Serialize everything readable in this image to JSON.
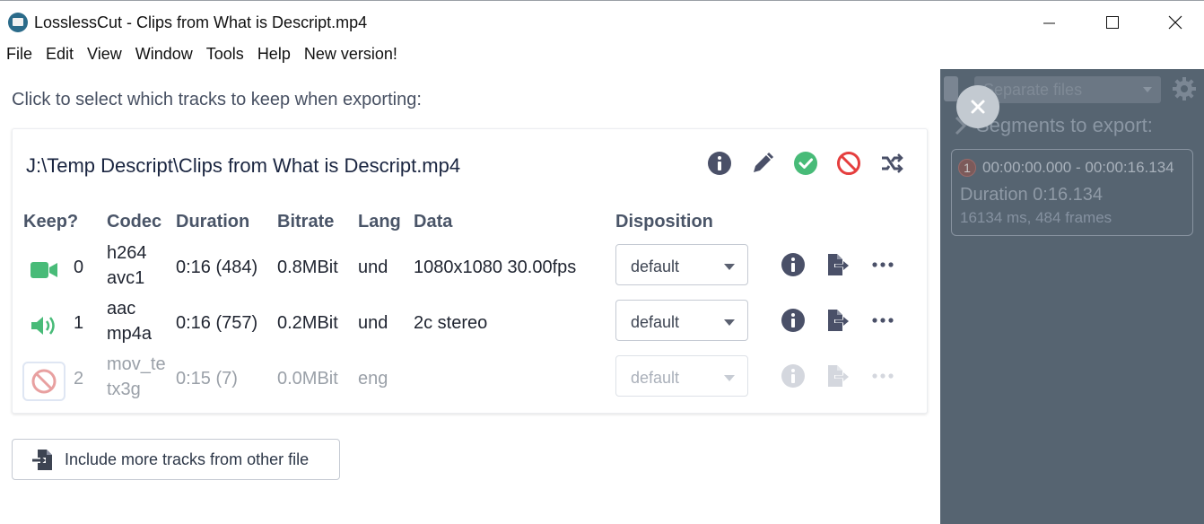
{
  "window": {
    "title": "LosslessCut - Clips from What is Descript.mp4",
    "icons": [
      "app-icon",
      "minimize-icon",
      "maximize-icon",
      "close-icon"
    ]
  },
  "menu": [
    "File",
    "Edit",
    "View",
    "Window",
    "Tools",
    "Help",
    "New version!"
  ],
  "instruction": "Click to select which tracks to keep when exporting:",
  "file": {
    "path": "J:\\Temp Descript\\Clips from What is Descript.mp4",
    "actions": [
      "info-icon",
      "edit-icon",
      "check-all-icon",
      "disable-all-icon",
      "shuffle-icon"
    ]
  },
  "table": {
    "headers": {
      "keep": "Keep?",
      "codec": "Codec",
      "duration": "Duration",
      "bitrate": "Bitrate",
      "lang": "Lang",
      "data": "Data",
      "disposition": "Disposition"
    },
    "rows": [
      {
        "index": "0",
        "kind": "video",
        "enabled": true,
        "codec1": "h264",
        "codec2": "avc1",
        "duration": "0:16 (484)",
        "bitrate": "0.8MBit",
        "lang": "und",
        "data": "1080x1080 30.00fps",
        "disposition": "default"
      },
      {
        "index": "1",
        "kind": "audio",
        "enabled": true,
        "codec1": "aac",
        "codec2": "mp4a",
        "duration": "0:16 (757)",
        "bitrate": "0.2MBit",
        "lang": "und",
        "data": "2c stereo",
        "disposition": "default"
      },
      {
        "index": "2",
        "kind": "subtitle",
        "enabled": false,
        "codec1": "mov_te",
        "codec2": "tx3g",
        "duration": "0:15 (7)",
        "bitrate": "0.0MBit",
        "lang": "eng",
        "data": "",
        "disposition": "default"
      }
    ]
  },
  "include_button": "Include more tracks from other file",
  "side_panel": {
    "mode": "Separate files",
    "heading": "Segments to export:",
    "segment": {
      "number": "1",
      "range": "00:00:00.000 - 00:00:16.134",
      "duration": "Duration 0:16.134",
      "details": "16134 ms, 484 frames"
    }
  },
  "colors": {
    "accent_green": "#48bb78",
    "danger_red": "#e53e3e",
    "icon_dark": "#4a5068",
    "panel_bg": "#566471"
  }
}
